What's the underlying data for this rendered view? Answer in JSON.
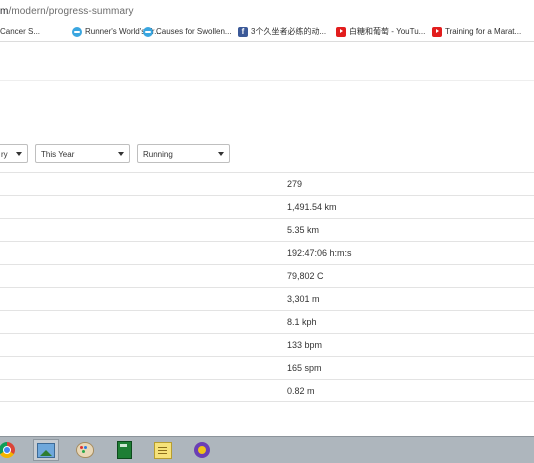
{
  "browser": {
    "url_host": "m",
    "url_path": "/modern/progress-summary",
    "bookmarks": [
      {
        "label": "Cancer S...",
        "icon": "none"
      },
      {
        "label": "Runner's World's Tr...",
        "icon": "runner-icon"
      },
      {
        "label": "Causes for Swollen...",
        "icon": "runner-icon"
      },
      {
        "label": "3个久坐者必练的动...",
        "icon": "facebook-icon"
      },
      {
        "label": "白糖和葡萄 - YouTu...",
        "icon": "youtube-icon"
      },
      {
        "label": "Training for a Marat...",
        "icon": "youtube-icon"
      }
    ]
  },
  "filters": {
    "period_type": "ry",
    "year": "This Year",
    "activity": "Running"
  },
  "stats": [
    {
      "value": "279"
    },
    {
      "value": "1,491.54 km"
    },
    {
      "value": "5.35 km"
    },
    {
      "value": "192:47:06 h:m:s"
    },
    {
      "value": "79,802 C"
    },
    {
      "value": "3,301 m"
    },
    {
      "value": "8.1 kph"
    },
    {
      "value": "133 bpm"
    },
    {
      "value": "165 spm"
    },
    {
      "value": "0.82 m"
    }
  ],
  "taskbar": {
    "apps": [
      "chrome-icon",
      "photos-icon",
      "paint-icon",
      "calculator-icon",
      "sticky-notes-icon",
      "norton-icon"
    ]
  }
}
